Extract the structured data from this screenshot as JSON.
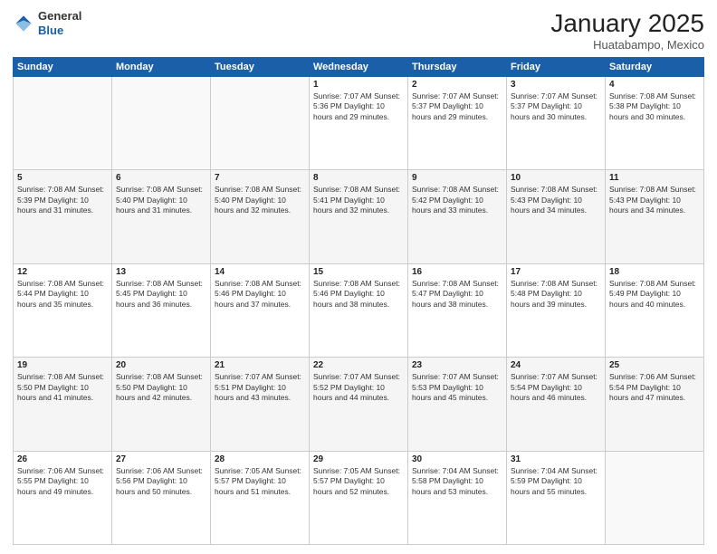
{
  "header": {
    "logo_general": "General",
    "logo_blue": "Blue",
    "title": "January 2025",
    "subtitle": "Huatabampo, Mexico"
  },
  "days_of_week": [
    "Sunday",
    "Monday",
    "Tuesday",
    "Wednesday",
    "Thursday",
    "Friday",
    "Saturday"
  ],
  "weeks": [
    [
      {
        "num": "",
        "info": ""
      },
      {
        "num": "",
        "info": ""
      },
      {
        "num": "",
        "info": ""
      },
      {
        "num": "1",
        "info": "Sunrise: 7:07 AM\nSunset: 5:36 PM\nDaylight: 10 hours\nand 29 minutes."
      },
      {
        "num": "2",
        "info": "Sunrise: 7:07 AM\nSunset: 5:37 PM\nDaylight: 10 hours\nand 29 minutes."
      },
      {
        "num": "3",
        "info": "Sunrise: 7:07 AM\nSunset: 5:37 PM\nDaylight: 10 hours\nand 30 minutes."
      },
      {
        "num": "4",
        "info": "Sunrise: 7:08 AM\nSunset: 5:38 PM\nDaylight: 10 hours\nand 30 minutes."
      }
    ],
    [
      {
        "num": "5",
        "info": "Sunrise: 7:08 AM\nSunset: 5:39 PM\nDaylight: 10 hours\nand 31 minutes."
      },
      {
        "num": "6",
        "info": "Sunrise: 7:08 AM\nSunset: 5:40 PM\nDaylight: 10 hours\nand 31 minutes."
      },
      {
        "num": "7",
        "info": "Sunrise: 7:08 AM\nSunset: 5:40 PM\nDaylight: 10 hours\nand 32 minutes."
      },
      {
        "num": "8",
        "info": "Sunrise: 7:08 AM\nSunset: 5:41 PM\nDaylight: 10 hours\nand 32 minutes."
      },
      {
        "num": "9",
        "info": "Sunrise: 7:08 AM\nSunset: 5:42 PM\nDaylight: 10 hours\nand 33 minutes."
      },
      {
        "num": "10",
        "info": "Sunrise: 7:08 AM\nSunset: 5:43 PM\nDaylight: 10 hours\nand 34 minutes."
      },
      {
        "num": "11",
        "info": "Sunrise: 7:08 AM\nSunset: 5:43 PM\nDaylight: 10 hours\nand 34 minutes."
      }
    ],
    [
      {
        "num": "12",
        "info": "Sunrise: 7:08 AM\nSunset: 5:44 PM\nDaylight: 10 hours\nand 35 minutes."
      },
      {
        "num": "13",
        "info": "Sunrise: 7:08 AM\nSunset: 5:45 PM\nDaylight: 10 hours\nand 36 minutes."
      },
      {
        "num": "14",
        "info": "Sunrise: 7:08 AM\nSunset: 5:46 PM\nDaylight: 10 hours\nand 37 minutes."
      },
      {
        "num": "15",
        "info": "Sunrise: 7:08 AM\nSunset: 5:46 PM\nDaylight: 10 hours\nand 38 minutes."
      },
      {
        "num": "16",
        "info": "Sunrise: 7:08 AM\nSunset: 5:47 PM\nDaylight: 10 hours\nand 38 minutes."
      },
      {
        "num": "17",
        "info": "Sunrise: 7:08 AM\nSunset: 5:48 PM\nDaylight: 10 hours\nand 39 minutes."
      },
      {
        "num": "18",
        "info": "Sunrise: 7:08 AM\nSunset: 5:49 PM\nDaylight: 10 hours\nand 40 minutes."
      }
    ],
    [
      {
        "num": "19",
        "info": "Sunrise: 7:08 AM\nSunset: 5:50 PM\nDaylight: 10 hours\nand 41 minutes."
      },
      {
        "num": "20",
        "info": "Sunrise: 7:08 AM\nSunset: 5:50 PM\nDaylight: 10 hours\nand 42 minutes."
      },
      {
        "num": "21",
        "info": "Sunrise: 7:07 AM\nSunset: 5:51 PM\nDaylight: 10 hours\nand 43 minutes."
      },
      {
        "num": "22",
        "info": "Sunrise: 7:07 AM\nSunset: 5:52 PM\nDaylight: 10 hours\nand 44 minutes."
      },
      {
        "num": "23",
        "info": "Sunrise: 7:07 AM\nSunset: 5:53 PM\nDaylight: 10 hours\nand 45 minutes."
      },
      {
        "num": "24",
        "info": "Sunrise: 7:07 AM\nSunset: 5:54 PM\nDaylight: 10 hours\nand 46 minutes."
      },
      {
        "num": "25",
        "info": "Sunrise: 7:06 AM\nSunset: 5:54 PM\nDaylight: 10 hours\nand 47 minutes."
      }
    ],
    [
      {
        "num": "26",
        "info": "Sunrise: 7:06 AM\nSunset: 5:55 PM\nDaylight: 10 hours\nand 49 minutes."
      },
      {
        "num": "27",
        "info": "Sunrise: 7:06 AM\nSunset: 5:56 PM\nDaylight: 10 hours\nand 50 minutes."
      },
      {
        "num": "28",
        "info": "Sunrise: 7:05 AM\nSunset: 5:57 PM\nDaylight: 10 hours\nand 51 minutes."
      },
      {
        "num": "29",
        "info": "Sunrise: 7:05 AM\nSunset: 5:57 PM\nDaylight: 10 hours\nand 52 minutes."
      },
      {
        "num": "30",
        "info": "Sunrise: 7:04 AM\nSunset: 5:58 PM\nDaylight: 10 hours\nand 53 minutes."
      },
      {
        "num": "31",
        "info": "Sunrise: 7:04 AM\nSunset: 5:59 PM\nDaylight: 10 hours\nand 55 minutes."
      },
      {
        "num": "",
        "info": ""
      }
    ]
  ]
}
